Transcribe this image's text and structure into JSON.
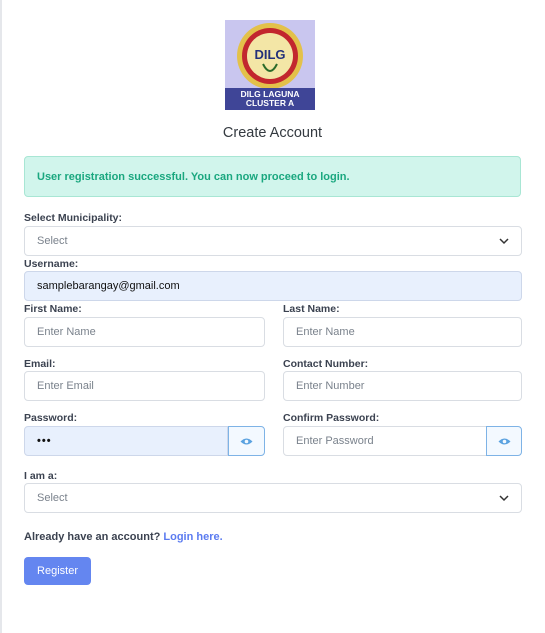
{
  "logo": {
    "badge_text": "DILG",
    "caption_line1": "DILG LAGUNA",
    "caption_line2": "CLUSTER A"
  },
  "page": {
    "title": "Create Account"
  },
  "alert": {
    "message": "User registration successful. You can now proceed to login."
  },
  "form": {
    "municipality": {
      "label": "Select Municipality:",
      "value": "Select"
    },
    "username": {
      "label": "Username:",
      "value": "samplebarangay@gmail.com"
    },
    "first_name": {
      "label": "First Name:",
      "placeholder": "Enter Name"
    },
    "last_name": {
      "label": "Last Name:",
      "placeholder": "Enter Name"
    },
    "email": {
      "label": "Email:",
      "placeholder": "Enter Email"
    },
    "contact_number": {
      "label": "Contact Number:",
      "placeholder": "Enter Number"
    },
    "password": {
      "label": "Password:",
      "value": "•••"
    },
    "confirm_password": {
      "label": "Confirm Password:",
      "placeholder": "Enter Password"
    },
    "role": {
      "label": "I am a:",
      "value": "Select"
    }
  },
  "footer": {
    "prompt": "Already have an account?",
    "link": "Login here."
  },
  "register_button": {
    "label": "Register"
  },
  "colors": {
    "accent": "#6486f0",
    "success_bg": "#d1f5ec",
    "success_text": "#1aa77f"
  },
  "icons": [
    "eye-icon",
    "chevron-down-icon"
  ]
}
